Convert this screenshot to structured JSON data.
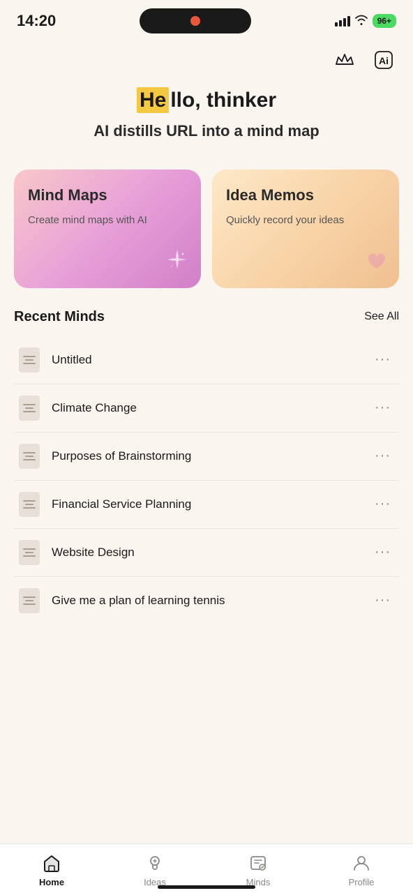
{
  "statusBar": {
    "time": "14:20",
    "battery": "96+"
  },
  "topActions": {
    "crownLabel": "premium",
    "aiLabel": "ai-assist"
  },
  "hero": {
    "helloHighlight": "He",
    "helloRest": "llo, thinker",
    "subtitle": "AI distills URL into a mind map"
  },
  "cards": [
    {
      "id": "mind-maps",
      "title": "Mind Maps",
      "description": "Create mind maps with AI",
      "iconType": "sparkle"
    },
    {
      "id": "idea-memos",
      "title": "Idea Memos",
      "description": "Quickly record your ideas",
      "iconType": "heart"
    }
  ],
  "recentMinds": {
    "sectionTitle": "Recent Minds",
    "seeAllLabel": "See All",
    "items": [
      {
        "id": 1,
        "name": "Untitled"
      },
      {
        "id": 2,
        "name": "Climate Change"
      },
      {
        "id": 3,
        "name": "Purposes of Brainstorming"
      },
      {
        "id": 4,
        "name": "Financial Service Planning"
      },
      {
        "id": 5,
        "name": "Website Design"
      },
      {
        "id": 6,
        "name": "Give me a plan of learning tennis"
      }
    ],
    "moreLabel": "···"
  },
  "bottomNav": {
    "items": [
      {
        "id": "home",
        "label": "Home",
        "active": true
      },
      {
        "id": "ideas",
        "label": "Ideas",
        "active": false
      },
      {
        "id": "minds",
        "label": "Minds",
        "active": false
      },
      {
        "id": "profile",
        "label": "Profile",
        "active": false
      }
    ]
  }
}
